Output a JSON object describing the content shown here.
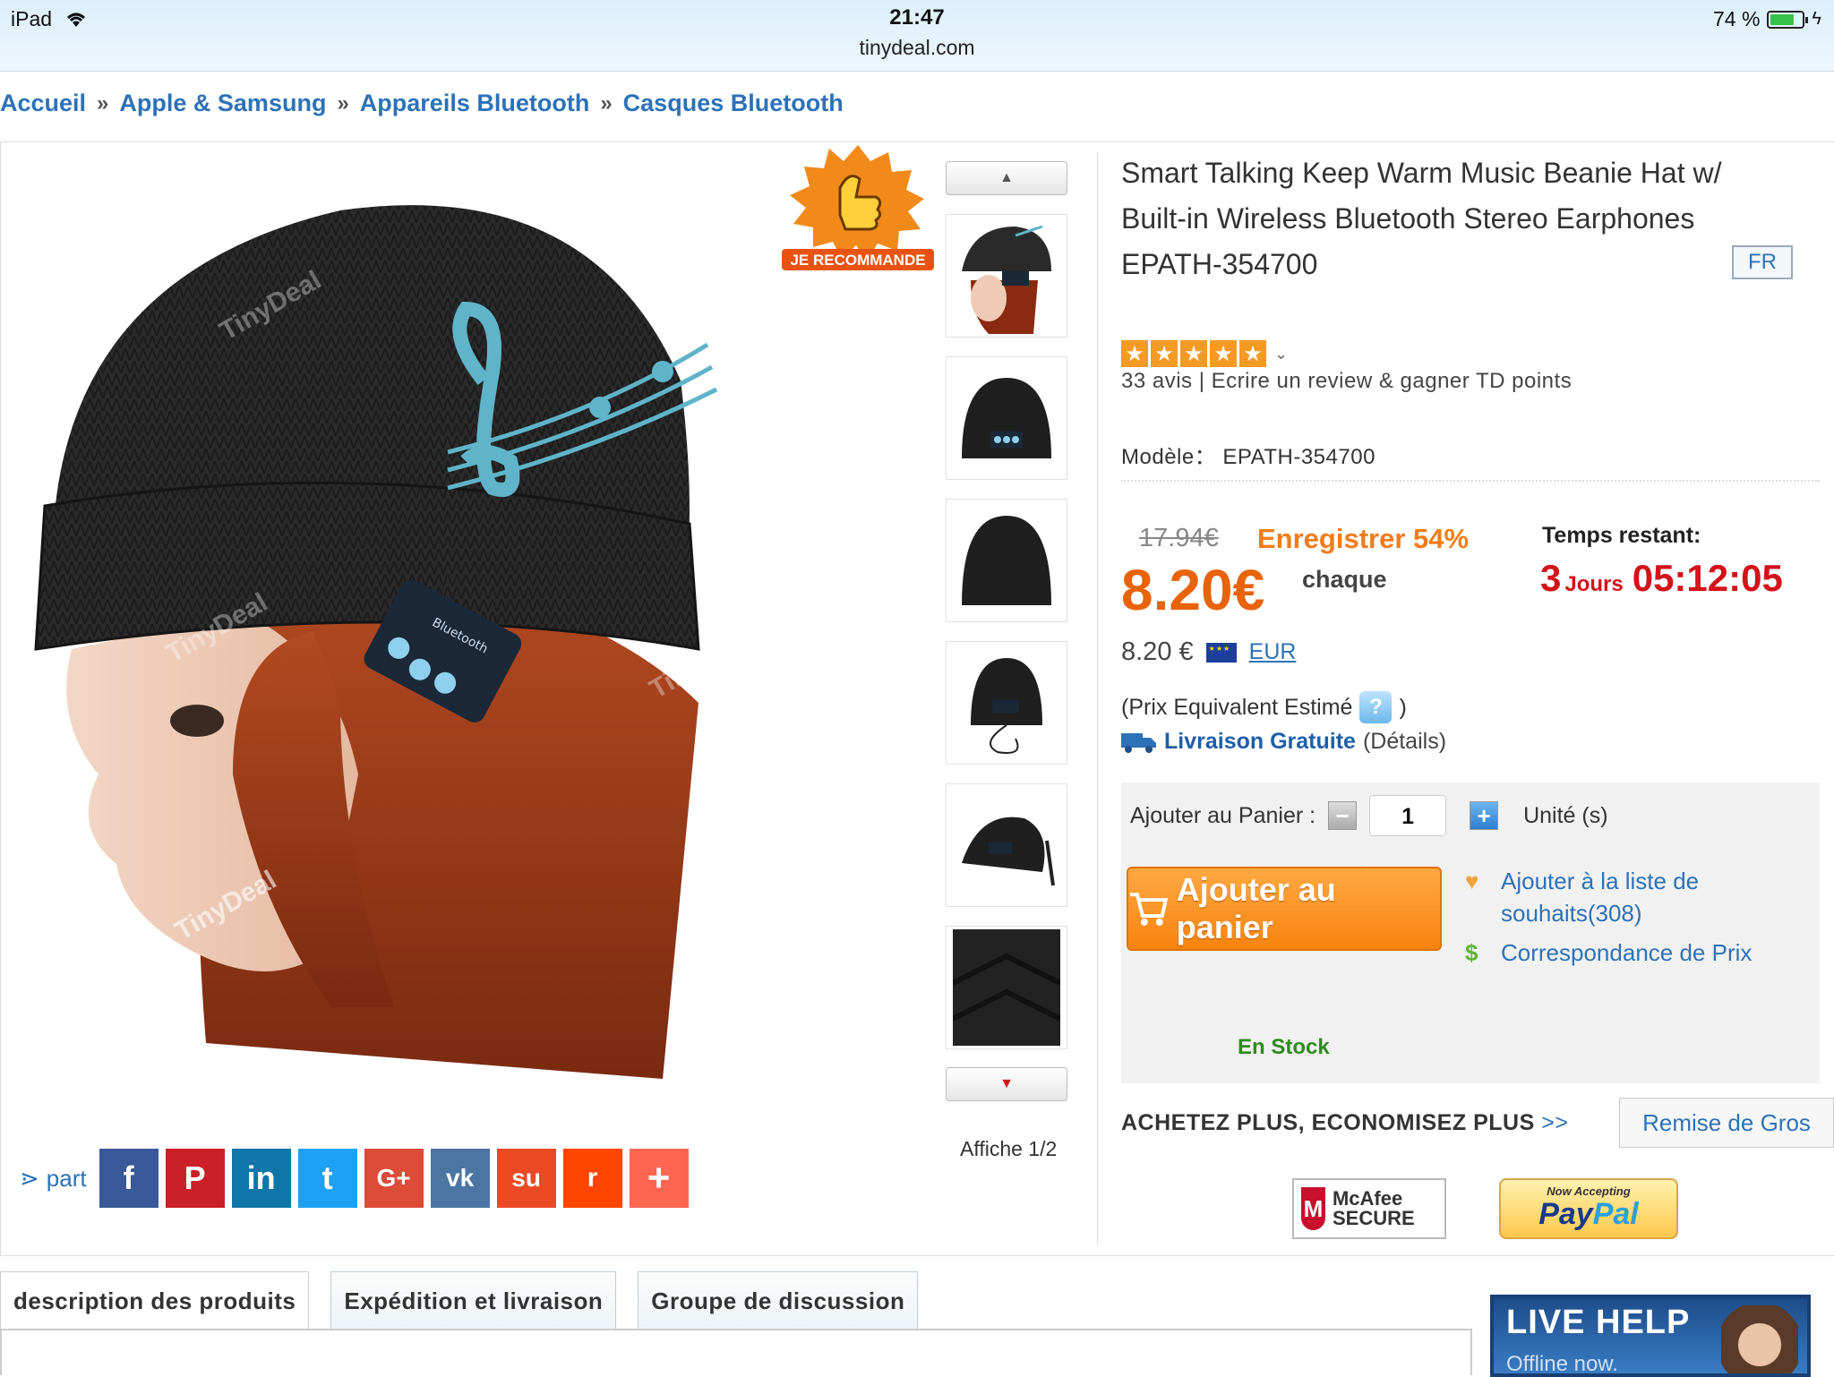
{
  "status_bar": {
    "device": "iPad",
    "time": "21:47",
    "url": "tinydeal.com",
    "battery": "74 %"
  },
  "breadcrumb": [
    "Accueil",
    "Apple & Samsung",
    "Appareils Bluetooth",
    "Casques Bluetooth"
  ],
  "breadcrumb_sep": "»",
  "badge_text": "JE RECOMMANDE",
  "watermark": "TinyDeal",
  "thumbnails": {
    "count_label": "Affiche 1/2"
  },
  "share": {
    "label": "part",
    "networks": [
      "f",
      "P",
      "in",
      "t",
      "G+",
      "vk",
      "su",
      "r",
      "+"
    ]
  },
  "product": {
    "title": "Smart Talking Keep Warm Music Beanie Hat w/ Built-in Wireless Bluetooth Stereo Earphones EPATH-354700",
    "lang": "FR",
    "rating": 5,
    "reviews_count": "33 avis",
    "review_sep": "|",
    "review_cta": "Ecrire un review & gagner TD points",
    "model_label": "Modèle：",
    "model_value": "EPATH-354700"
  },
  "pricing": {
    "old_price": "17.94€",
    "save": "Enregistrer 54%",
    "price": "8.20€",
    "per": "chaque",
    "time_label": "Temps restant:",
    "days": "3",
    "days_label": "Jours",
    "time_left": "05:12:05",
    "converted": "8.20 €",
    "currency": "EUR",
    "equiv_label": "(Prix Equivalent Estimé",
    "equiv_close": ")",
    "free_shipping": "Livraison Gratuite",
    "details": "(Détails)"
  },
  "cart": {
    "qty_label": "Ajouter au Panier :",
    "qty": "1",
    "unit": "Unité (s)",
    "add_button": "Ajouter au panier",
    "wishlist": "Ajouter à la liste de souhaits(308)",
    "price_match": "Correspondance de Prix",
    "stock": "En Stock"
  },
  "bulk": {
    "label": "ACHETEZ PLUS, ECONOMISEZ PLUS",
    "arrows": ">>",
    "button": "Remise de Gros"
  },
  "trust": {
    "mcafee": "McAfee SECURE",
    "paypal_top": "Now Accepting",
    "paypal_pay": "Pay",
    "paypal_pal": "Pal"
  },
  "tabs": [
    "description des produits",
    "Expédition et livraison",
    "Groupe de discussion"
  ],
  "live_help": {
    "title": "LIVE HELP",
    "status": "Offline now."
  },
  "colors": {
    "link": "#2d72b8",
    "price": "#e8630a",
    "timer": "#d4121b",
    "cta": "#f7830e",
    "stock": "#2e8b1e"
  }
}
